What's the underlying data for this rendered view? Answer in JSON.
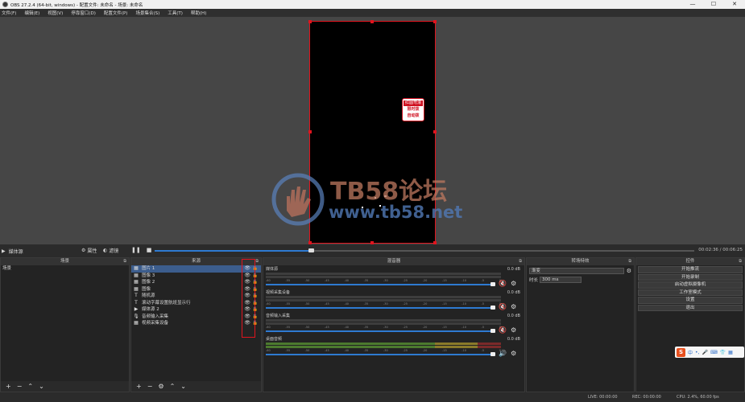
{
  "window": {
    "title": "OBS 27.2.4 (64-bit, windows) - 配置文件: 未命名 - 场景: 未命名",
    "minimize": "—",
    "maximize": "☐",
    "close": "✕"
  },
  "menu": [
    "文件(F)",
    "编辑(E)",
    "视图(V)",
    "停靠窗口(D)",
    "配置文件(P)",
    "场景集合(S)",
    "工具(T)",
    "帮助(H)"
  ],
  "preview": {
    "badge_line1": "红圆弯滚",
    "badge_line2": "限时拨",
    "badge_line3": "自动拨",
    "watermark_title": "TB58论坛",
    "watermark_url": "www.tb58.net",
    "colors": {
      "canvas_outline": "#e0141e",
      "preview_bg": "#464646"
    }
  },
  "toolbar": {
    "scene_item": "媒体源",
    "properties": "属性",
    "filters": "滤镜",
    "time": "00:02:36 / 00:06:25",
    "seek_progress": 0.29
  },
  "scenes": {
    "title": "场景",
    "items": [
      "场景"
    ]
  },
  "sources": {
    "title": "来源",
    "items": [
      {
        "icon": "▦",
        "label": "图片 1"
      },
      {
        "icon": "▦",
        "label": "图像 3"
      },
      {
        "icon": "▦",
        "label": "图像 2"
      },
      {
        "icon": "▦",
        "label": "图像"
      },
      {
        "icon": "T",
        "label": "随机源"
      },
      {
        "icon": "T",
        "label": "滚动字幕设置航班显示行"
      },
      {
        "icon": "▶",
        "label": "媒体源 2"
      },
      {
        "icon": "🎙",
        "label": "音频输入采集"
      },
      {
        "icon": "▦",
        "label": "视频采集设备"
      }
    ]
  },
  "mixer": {
    "title": "混音器",
    "ticks": [
      "-60",
      "-55",
      "-50",
      "-45",
      "-40",
      "-35",
      "-30",
      "-25",
      "-20",
      "-15",
      "-10",
      "-5",
      "0"
    ],
    "channels": [
      {
        "name": "媒体源",
        "db": "0.0 dB"
      },
      {
        "name": "视频采集设备",
        "db": "0.0 dB"
      },
      {
        "name": "音频输入采集",
        "db": "0.0 dB"
      },
      {
        "name": "桌面音频",
        "db": "0.0 dB"
      }
    ]
  },
  "transitions": {
    "title": "转场特效",
    "selected": "渐变",
    "duration_label": "时长",
    "duration_value": "300 ms"
  },
  "controls": {
    "title": "控件",
    "buttons": [
      "开始推流",
      "开始录制",
      "启动虚拟摄像机",
      "工作室模式",
      "设置",
      "退出"
    ]
  },
  "status": {
    "live": "LIVE: 00:00:00",
    "rec": "REC: 00:00:00",
    "cpu": "CPU: 2.4%, 60.00 fps"
  },
  "ime": {
    "mode": "中"
  }
}
